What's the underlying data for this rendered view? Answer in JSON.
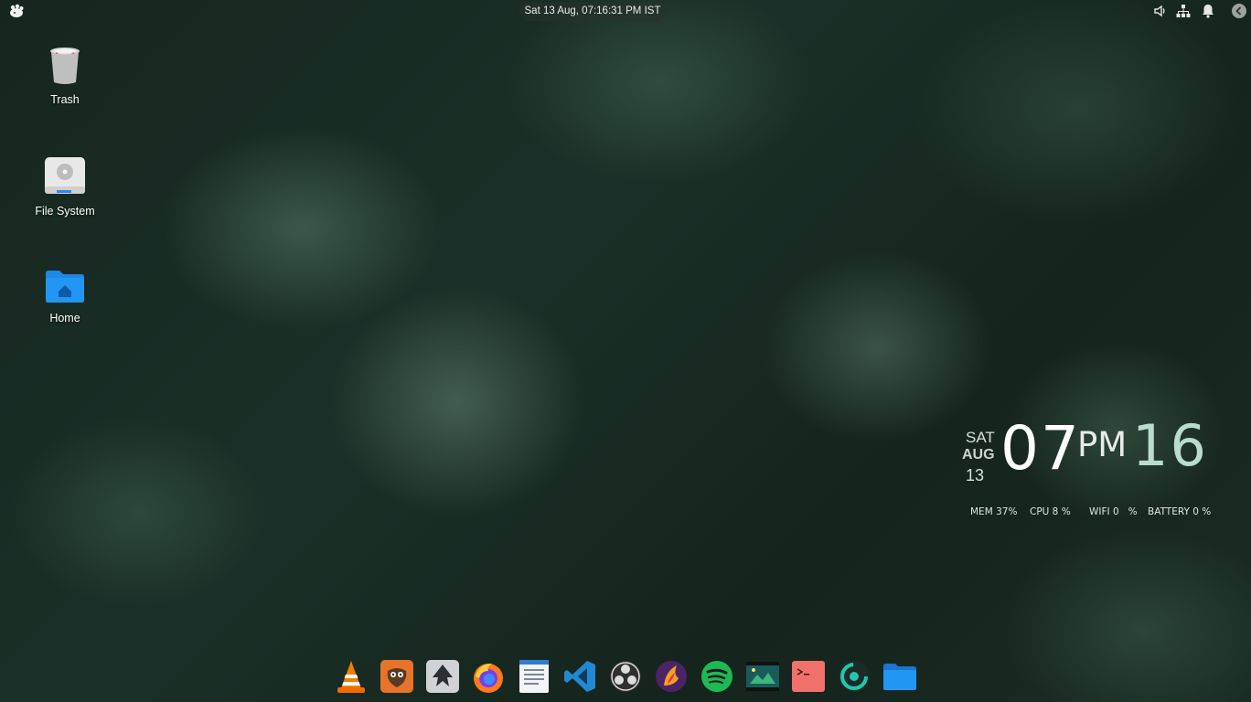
{
  "top_panel": {
    "datetime": "Sat 13 Aug, 07:16:31 PM IST",
    "tray_icons": [
      "volume-icon",
      "network-icon",
      "notification-bell-icon",
      "back-arrow-icon"
    ]
  },
  "desktop": {
    "icons": [
      {
        "label": "Trash",
        "icon": "trash-icon"
      },
      {
        "label": "File System",
        "icon": "drive-icon"
      },
      {
        "label": "Home",
        "icon": "home-folder-icon"
      }
    ]
  },
  "widget": {
    "day": "SAT",
    "month": "AUG",
    "date": "13",
    "hour": "07",
    "ampm": "PM",
    "minute": "16",
    "mem": "MEM 37%",
    "cpu": "CPU 8 %",
    "wifi": "WIFI 0   %",
    "battery": "BATTERY 0 %"
  },
  "dock": {
    "apps": [
      "vlc-icon",
      "gimp-icon",
      "inkscape-icon",
      "firefox-icon",
      "text-editor-icon",
      "vscode-icon",
      "obs-icon",
      "kdenlive-icon",
      "spotify-icon",
      "image-viewer-icon",
      "terminal-icon",
      "monitor-app-icon",
      "files-icon"
    ]
  }
}
